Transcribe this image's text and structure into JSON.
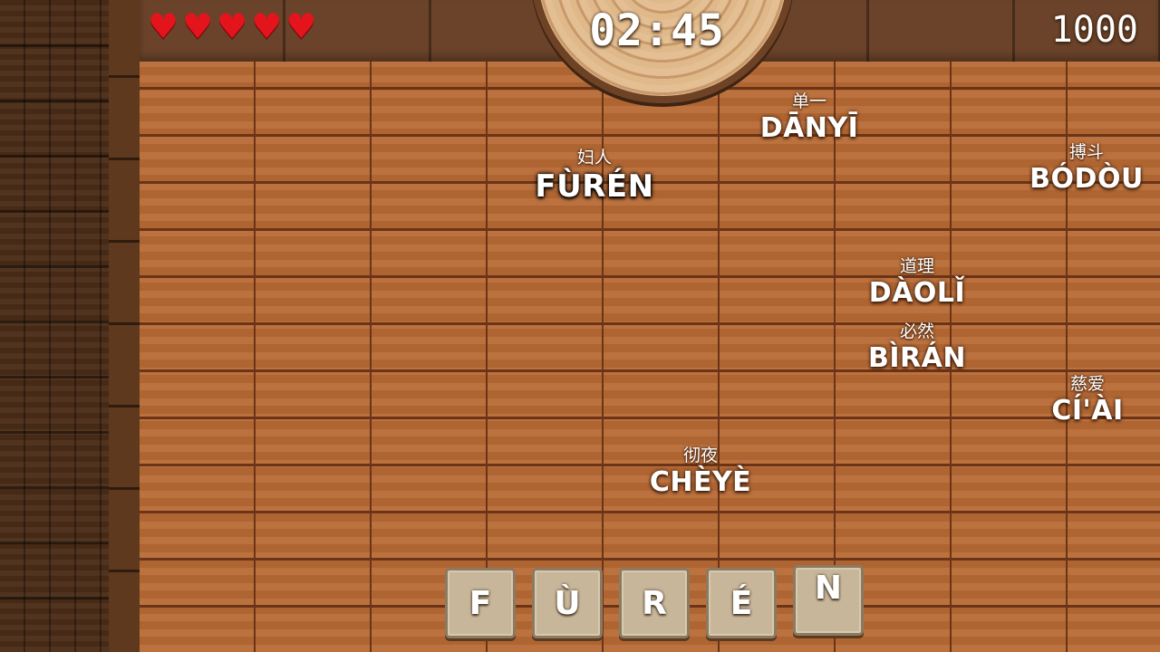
{
  "hud": {
    "lives": 5,
    "heart_glyph": "♥",
    "timer": "02:45",
    "score": "1000"
  },
  "words": [
    {
      "hanzi": "单一",
      "pinyin": "DĀNYĪ",
      "active": false
    },
    {
      "hanzi": "妇人",
      "pinyin": "FÙRÉN",
      "active": true
    },
    {
      "hanzi": "搏斗",
      "pinyin": "BÓDÒU",
      "active": false
    },
    {
      "hanzi": "道理",
      "pinyin": "DÀOLǏ",
      "active": false
    },
    {
      "hanzi": "必然",
      "pinyin": "BÌRÁN",
      "active": false
    },
    {
      "hanzi": "慈爱",
      "pinyin": "CÍ'ÀI",
      "active": false
    },
    {
      "hanzi": "彻夜",
      "pinyin": "CHÈYÈ",
      "active": false
    }
  ],
  "tiles": [
    "F",
    "Ù",
    "R",
    "É",
    "N"
  ],
  "colors": {
    "heart": "#e3141c",
    "brick": "#b86a35",
    "tile": "#c7b69a"
  }
}
